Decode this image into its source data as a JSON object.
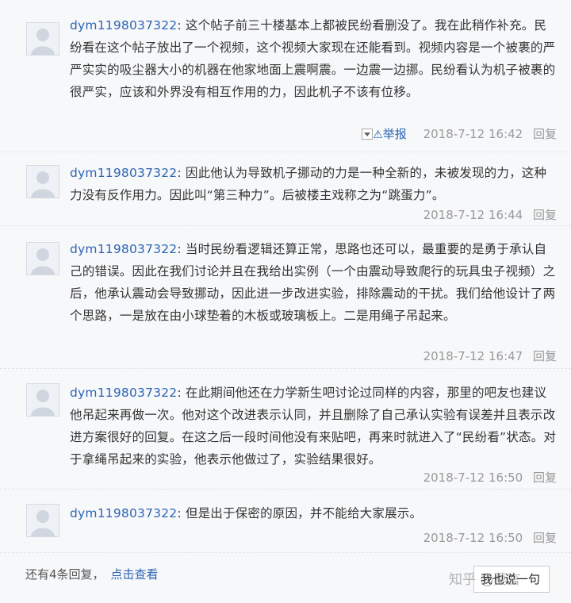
{
  "posts": [
    {
      "username": "dym1198037322",
      "text": ": 这个帖子前三十楼基本上都被民纷看删没了。我在此稍作补充。民纷看在这个帖子放出了一个视频，这个视频大家现在还能看到。视频内容是一个被裹的严严实实的吸尘器大小的机器在他家地面上震啊震。一边震一边挪。民纷看认为机子被裹的很严实，应该和外界没有相互作用的力，因此机子不该有位移。",
      "report": "举报",
      "time": "2018-7-12 16:42",
      "reply": "回复"
    },
    {
      "username": "dym1198037322",
      "text": ": 因此他认为导致机子挪动的力是一种全新的，未被发现的力，这种力没有反作用力。因此叫“第三种力”。后被楼主戏称之为“跳蛋力”。",
      "time": "2018-7-12 16:44",
      "reply": "回复"
    },
    {
      "username": "dym1198037322",
      "text": ": 当时民纷看逻辑还算正常，思路也还可以，最重要的是勇于承认自己的错误。因此在我们讨论并且在我给出实例（一个由震动导致爬行的玩具虫子视频）之后，他承认震动会导致挪动，因此进一步改进实验，排除震动的干扰。我们给他设计了两个思路，一是放在由小球垫着的木板或玻璃板上。二是用绳子吊起来。",
      "time": "2018-7-12 16:47",
      "reply": "回复"
    },
    {
      "username": "dym1198037322",
      "text": ": 在此期间他还在力学新生吧讨论过同样的内容，那里的吧友也建议他吊起来再做一次。他对这个改进表示认同，并且删除了自己承认实验有误差并且表示改进方案很好的回复。在这之后一段时间他没有来贴吧，再来时就进入了“民纷看”状态。对于拿绳吊起来的实验，他表示他做过了，实验结果很好。",
      "time": "2018-7-12 16:50",
      "reply": "回复"
    },
    {
      "username": "dym1198037322",
      "text": ": 但是出于保密的原因，并不能给大家展示。",
      "time": "2018-7-12 16:50",
      "reply": "回复"
    }
  ],
  "footer": {
    "more_count_text": "还有4条回复，",
    "more_link": "点击查看",
    "reply_button": "我也说一句"
  },
  "watermark": "知乎 @莫言",
  "icons": [
    "avatar-placeholder-icon",
    "warning-icon",
    "dropdown-icon"
  ],
  "colors": {
    "link": "#2d64b3",
    "meta": "#999999",
    "background": "#f7f8fa"
  }
}
